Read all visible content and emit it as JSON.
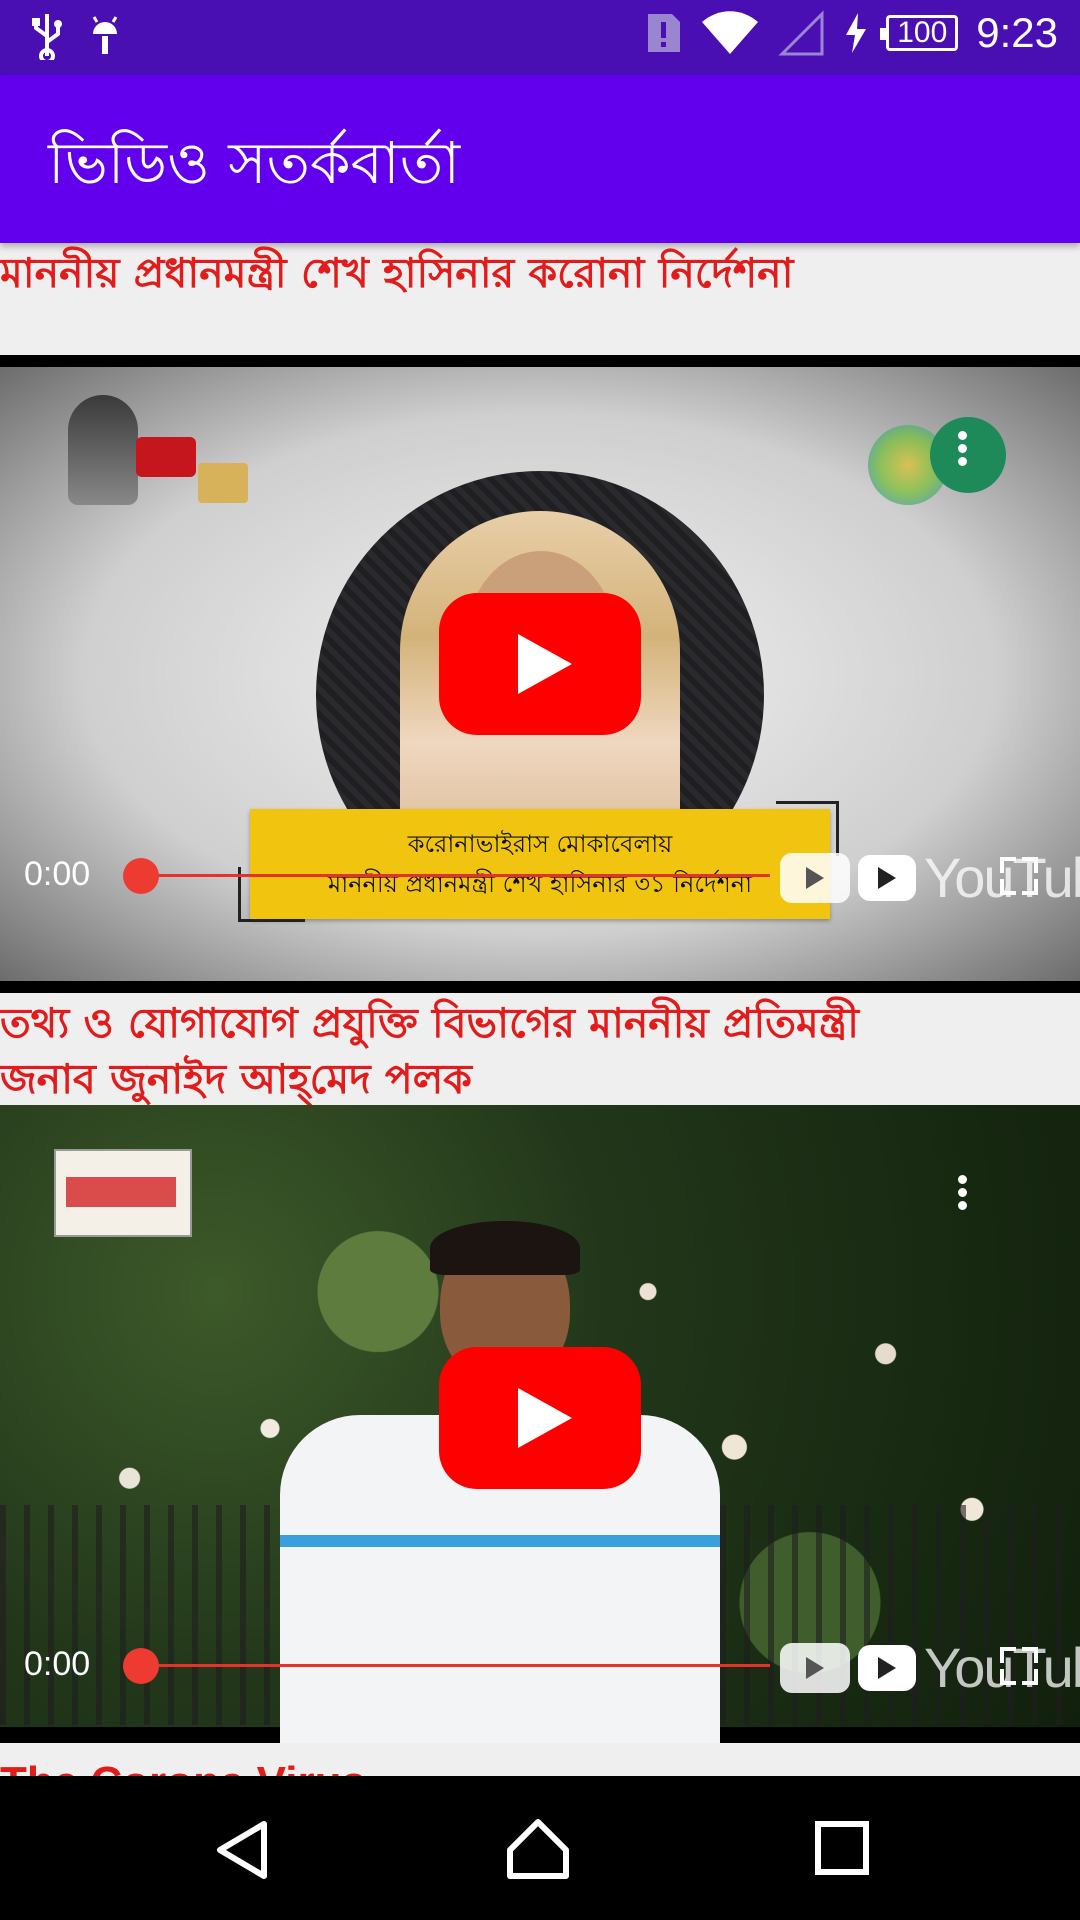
{
  "status_bar": {
    "time": "9:23",
    "battery": "100",
    "icons": [
      "usb-icon",
      "android-icon",
      "alert-icon",
      "wifi-icon",
      "signal-icon",
      "charging-icon"
    ]
  },
  "app_bar": {
    "title": "ভিডিও সতর্কবার্তা"
  },
  "videos": [
    {
      "title": "মাননীয় প্রধানমন্ত্রী শেখ হাসিনার করোনা নির্দেশনা",
      "time": "0:00",
      "banner_line1": "করোনাভাইরাস মোকাবেলায়",
      "banner_line2": "মাননীয় প্রধানমন্ত্রী শেখ হাসিনার ৩১ নির্দেশনা",
      "watermark": "YouTube",
      "progress": 0
    },
    {
      "title_line1": "তথ্য ও যোগাযোগ প্রযুক্তি বিভাগের মাননীয় প্রতিমন্ত্রী",
      "title_line2": "জনাব জুনাইদ আহ্‌মেদ পলক",
      "time": "0:00",
      "watermark": "YouTube",
      "progress": 0
    }
  ],
  "next_item_title": "The Corona Virus",
  "nav_bar": {
    "buttons": [
      "back-icon",
      "home-icon",
      "recents-icon"
    ]
  },
  "colors": {
    "status_bar": "#4a0fb3",
    "app_bar": "#6200ee",
    "title_red": "#e21b1b",
    "play_red": "#ff0000"
  }
}
